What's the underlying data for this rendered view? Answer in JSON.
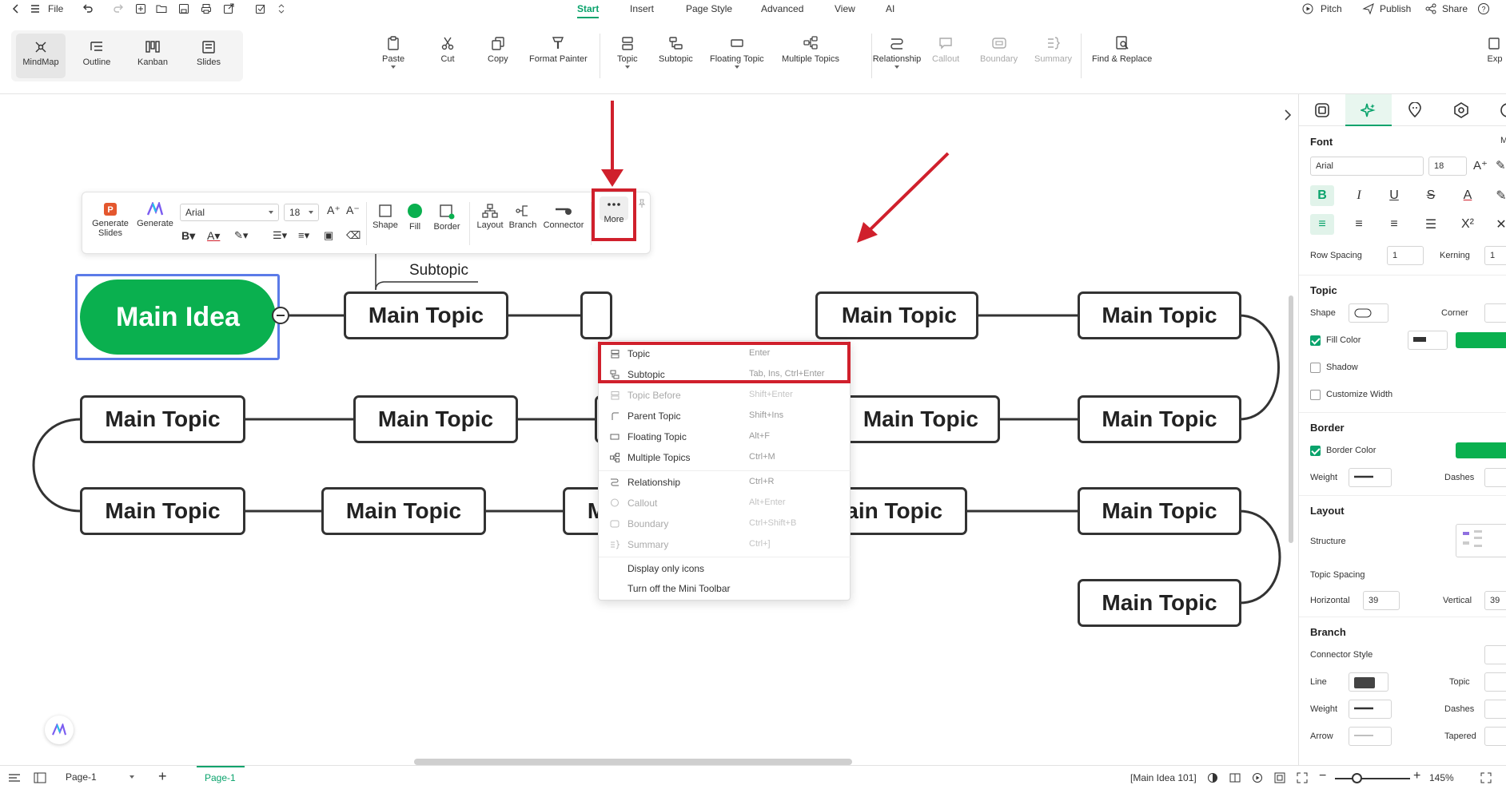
{
  "menubar": {
    "file": "File",
    "tabs": [
      "Start",
      "Insert",
      "Page Style",
      "Advanced",
      "View",
      "AI"
    ],
    "active_tab": "Start",
    "pitch": "Pitch",
    "publish": "Publish",
    "share": "Share"
  },
  "views": [
    {
      "label": "MindMap",
      "icon": "mindmap-icon"
    },
    {
      "label": "Outline",
      "icon": "outline-icon"
    },
    {
      "label": "Kanban",
      "icon": "kanban-icon"
    },
    {
      "label": "Slides",
      "icon": "slides-icon"
    }
  ],
  "ribbon": {
    "paste": "Paste",
    "cut": "Cut",
    "copy": "Copy",
    "format_painter": "Format Painter",
    "topic": "Topic",
    "subtopic": "Subtopic",
    "floating_topic": "Floating Topic",
    "multiple_topics": "Multiple Topics",
    "relationship": "Relationship",
    "callout": "Callout",
    "boundary": "Boundary",
    "summary": "Summary",
    "find_replace": "Find & Replace",
    "export": "Exp"
  },
  "mini_toolbar": {
    "generate_slides": "Generate Slides",
    "generate": "Generate",
    "font": "Arial",
    "size": "18",
    "shape": "Shape",
    "fill": "Fill",
    "border": "Border",
    "layout": "Layout",
    "branch": "Branch",
    "connector": "Connector",
    "more": "More"
  },
  "map": {
    "main_idea": "Main Idea",
    "subtopic": "Subtopic",
    "topic_label": "Main Topic"
  },
  "context_menu": {
    "items": [
      {
        "label": "Topic",
        "shortcut": "Enter",
        "disabled": false
      },
      {
        "label": "Subtopic",
        "shortcut": "Tab, Ins, Ctrl+Enter",
        "disabled": false
      },
      {
        "label": "Topic Before",
        "shortcut": "Shift+Enter",
        "disabled": true
      },
      {
        "label": "Parent Topic",
        "shortcut": "Shift+Ins",
        "disabled": false
      },
      {
        "label": "Floating Topic",
        "shortcut": "Alt+F",
        "disabled": false
      },
      {
        "label": "Multiple Topics",
        "shortcut": "Ctrl+M",
        "disabled": false
      },
      {
        "label": "Relationship",
        "shortcut": "Ctrl+R",
        "disabled": false
      },
      {
        "label": "Callout",
        "shortcut": "Alt+Enter",
        "disabled": true
      },
      {
        "label": "Boundary",
        "shortcut": "Ctrl+Shift+B",
        "disabled": true
      },
      {
        "label": "Summary",
        "shortcut": "Ctrl+]",
        "disabled": true
      },
      {
        "label": "Display only icons",
        "shortcut": "",
        "disabled": false
      },
      {
        "label": "Turn off the Mini Toolbar",
        "shortcut": "",
        "disabled": false
      }
    ]
  },
  "right_panel": {
    "font_heading": "Font",
    "font_name": "Arial",
    "font_size": "18",
    "row_spacing_label": "Row Spacing",
    "row_spacing": "1",
    "kerning_label": "Kerning",
    "kerning": "1",
    "topic_heading": "Topic",
    "shape_label": "Shape",
    "corner_label": "Corner",
    "fill_color_label": "Fill Color",
    "shadow_label": "Shadow",
    "customize_width_label": "Customize Width",
    "border_heading": "Border",
    "border_color_label": "Border Color",
    "weight_label": "Weight",
    "dashes_label": "Dashes",
    "layout_heading": "Layout",
    "structure_label": "Structure",
    "topic_spacing_label": "Topic Spacing",
    "horizontal_label": "Horizontal",
    "horizontal": "39",
    "vertical_label": "Vertical",
    "vertical": "39",
    "branch_heading": "Branch",
    "connector_style_label": "Connector Style",
    "line_label": "Line",
    "topic_label": "Topic",
    "branch_weight_label": "Weight",
    "branch_dashes_label": "Dashes",
    "arrow_label": "Arrow",
    "tapered_label": "Tapered",
    "m_label": "M"
  },
  "statusbar": {
    "page_select": "Page-1",
    "page_tab": "Page-1",
    "selection_info": "[Main Idea 101]",
    "zoom": "145%"
  },
  "colors": {
    "accent": "#0aa36c",
    "main_idea_fill": "#0ab04f",
    "highlight": "#d0202c",
    "selection": "#5b7be8"
  }
}
